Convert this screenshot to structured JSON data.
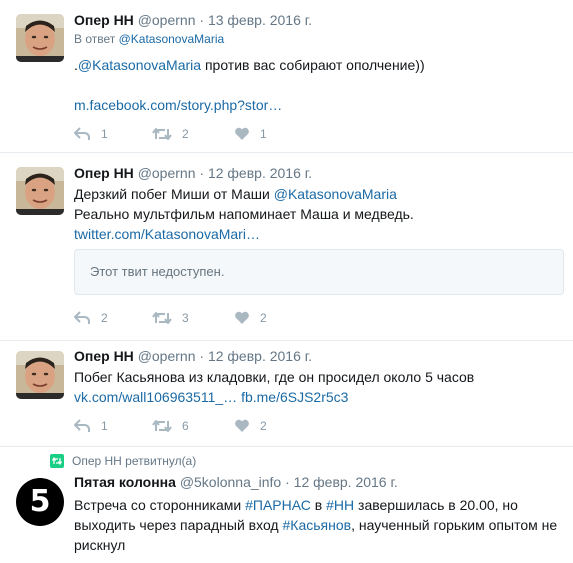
{
  "tweets": [
    {
      "fullname": "Опер НН",
      "username": "@opernn",
      "dot": "·",
      "time": "13 февр. 2016 г.",
      "reply_prefix": "В ответ ",
      "reply_to": "@KatasonovaMaria",
      "text_prefix": ".",
      "mention": "@KatasonovaMaria",
      "text_rest": " против вас собирают ополчение))",
      "link": "m.facebook.com/story.php?stor…",
      "replies": "1",
      "retweets": "2",
      "likes": "1"
    },
    {
      "fullname": "Опер НН",
      "username": "@opernn",
      "dot": "·",
      "time": "12 февр. 2016 г.",
      "line1_prefix": "Дерзкий побег Миши от Маши ",
      "mention": "@KatasonovaMaria",
      "line2": "Реально мультфильм напоминает Маша и медведь.",
      "link": "twitter.com/KatasonovaMari…",
      "quote": "Этот твит недоступен.",
      "replies": "2",
      "retweets": "3",
      "likes": "2"
    },
    {
      "fullname": "Опер НН",
      "username": "@opernn",
      "dot": "·",
      "time": "12 февр. 2016 г.",
      "text": "Побег Касьянова из кладовки, где он просидел около 5 часов",
      "link1": "vk.com/wall106963511_…",
      "link2": "fb.me/6SJS2r5c3",
      "replies": "1",
      "retweets": "6",
      "likes": "2"
    },
    {
      "retweeted_by": "Опер НН ретвитнул(а)",
      "fullname": "Пятая колонна",
      "username": "@5kolonna_info",
      "dot": "·",
      "time": "12 февр. 2016 г.",
      "avatar_text": "5",
      "t1": "Встреча со сторонниками ",
      "h1": "#ПАРНАС",
      "t2": " в ",
      "h2": "#НН",
      "t3": " завершилась в 20.00, но",
      "t4": "выходить через парадный вход ",
      "h3": "#Касьянов",
      "t5": ", наученный горьким опытом не",
      "t6": "рискнул"
    }
  ],
  "icons": {
    "reply": "reply-icon",
    "retweet": "retweet-icon",
    "like": "heart-icon"
  },
  "colors": {
    "link": "#1b6aa5",
    "muted": "#657786",
    "retweet_badge": "#19cf86"
  }
}
